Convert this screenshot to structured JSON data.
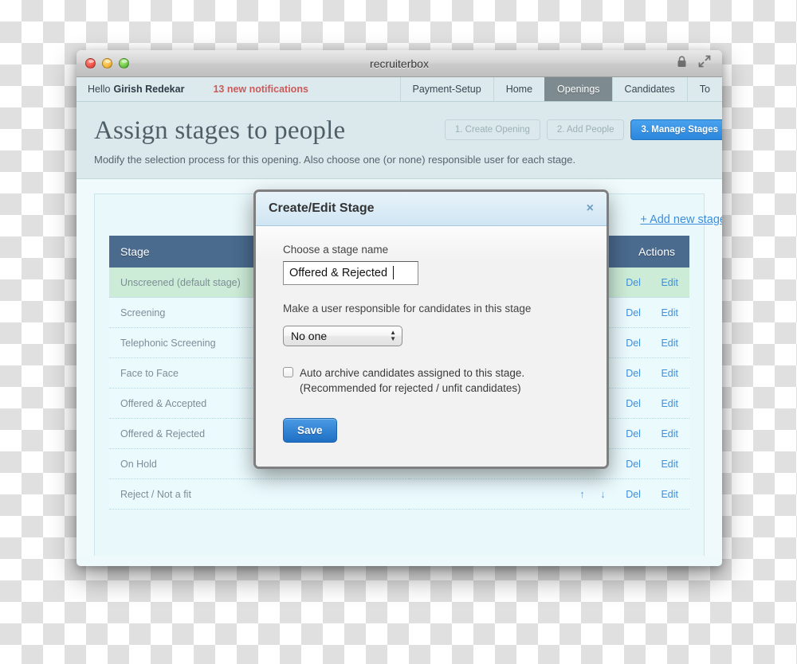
{
  "window": {
    "title": "recruiterbox",
    "lock_icon": "lock-icon",
    "expand_icon": "fullscreen-icon"
  },
  "navbar": {
    "greeting_prefix": "Hello",
    "greeting_name": "Girish Redekar",
    "notifications": "13 new notifications",
    "tabs": [
      {
        "label": "Payment-Setup",
        "active": false
      },
      {
        "label": "Home",
        "active": false
      },
      {
        "label": "Openings",
        "active": true
      },
      {
        "label": "Candidates",
        "active": false
      },
      {
        "label": "To",
        "active": false
      }
    ]
  },
  "page": {
    "title": "Assign stages to people",
    "subtitle": "Modify the selection process for this opening. Also choose one (or none) responsible user for each stage.",
    "steps": [
      {
        "label": "1. Create Opening",
        "active": false
      },
      {
        "label": "2. Add People",
        "active": false
      },
      {
        "label": "3. Manage Stages",
        "active": true
      }
    ],
    "add_new_link": "+ Add new stage"
  },
  "table": {
    "headers": {
      "stage": "Stage",
      "actions": "Actions"
    },
    "action_labels": {
      "up": "↑",
      "down": "↓",
      "delete": "Del",
      "edit": "Edit"
    },
    "rows": [
      {
        "stage": "Unscreened (default stage)",
        "highlight": true
      },
      {
        "stage": "Screening",
        "highlight": false
      },
      {
        "stage": "Telephonic Screening",
        "highlight": false
      },
      {
        "stage": "Face to Face",
        "highlight": false
      },
      {
        "stage": "Offered & Accepted",
        "highlight": false
      },
      {
        "stage": "Offered & Rejected",
        "highlight": false
      },
      {
        "stage": "On Hold",
        "highlight": false
      },
      {
        "stage": "Reject / Not a fit",
        "highlight": false
      }
    ]
  },
  "modal": {
    "title": "Create/Edit Stage",
    "close_label": "×",
    "name_label": "Choose a stage name",
    "name_value": "Offered & Rejected",
    "responsible_label": "Make a user responsible for candidates in this stage",
    "responsible_value": "No one",
    "responsible_options": [
      "No one"
    ],
    "archive_line1": "Auto archive candidates assigned to this stage.",
    "archive_line2": "(Recommended for rejected / unfit candidates)",
    "save_label": "Save"
  },
  "colors": {
    "accent_blue": "#2b87dd",
    "link_blue": "#3d8fdd",
    "table_header": "#4a6a8e",
    "highlight_green": "#ccecd7",
    "notification_red": "#cc5a5a"
  }
}
